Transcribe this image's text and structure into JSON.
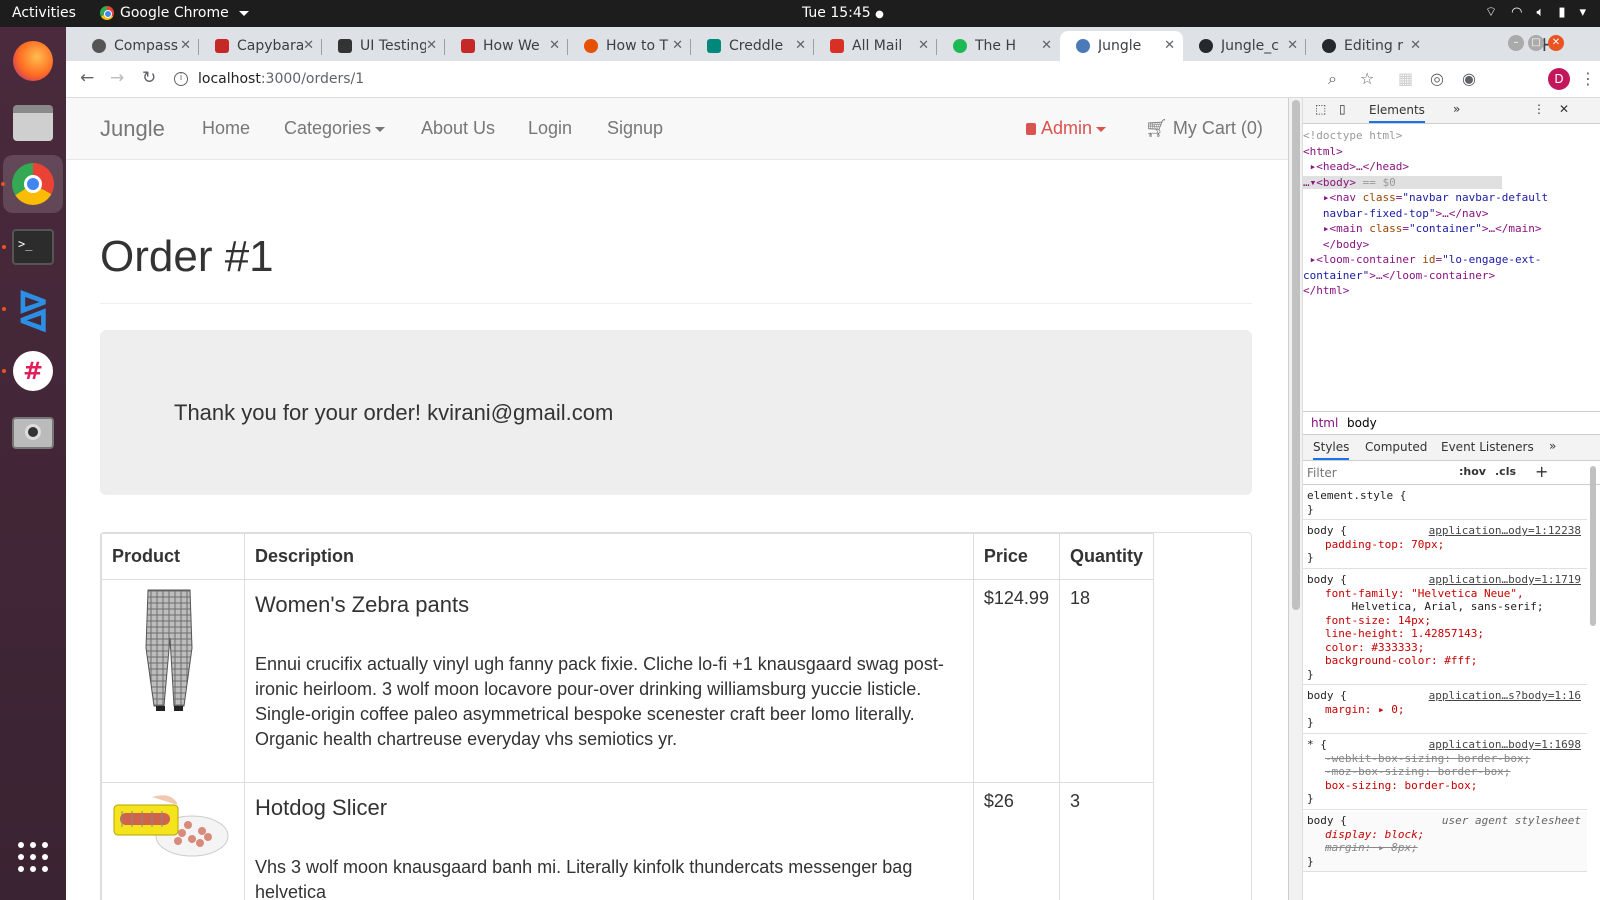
{
  "desktop": {
    "activities": "Activities",
    "app_name": "Google Chrome",
    "clock": "Tue 15:45"
  },
  "tabs": [
    {
      "title": "Compass",
      "color": "#555555"
    },
    {
      "title": "Capybara",
      "color": "#c62828"
    },
    {
      "title": "UI Testing",
      "color": "#333333"
    },
    {
      "title": "How We",
      "color": "#c62828"
    },
    {
      "title": "How to T",
      "color": "#e65100"
    },
    {
      "title": "Creddle",
      "color": "#00897b"
    },
    {
      "title": "All Mail",
      "color": "#d93025"
    },
    {
      "title": "The H",
      "color": "#1db954"
    },
    {
      "title": "Jungle",
      "color": "#4a7ab8"
    },
    {
      "title": "Jungle_c",
      "color": "#24292e"
    },
    {
      "title": "Editing r",
      "color": "#24292e"
    }
  ],
  "address": {
    "host": "localhost",
    "path": ":3000/orders/1"
  },
  "avatar_letter": "D",
  "navbar": {
    "brand": "Jungle",
    "home": "Home",
    "categories": "Categories",
    "about": "About Us",
    "login": "Login",
    "signup": "Signup",
    "admin": "Admin",
    "cart": "My Cart (0)"
  },
  "order": {
    "title": "Order #1",
    "thanks": "Thank you for your order! kvirani@gmail.com"
  },
  "table": {
    "headers": [
      "Product",
      "Description",
      "Price",
      "Quantity"
    ],
    "rows": [
      {
        "name": "Women's Zebra pants",
        "description": "Ennui crucifix actually vinyl ugh fanny pack fixie. Cliche lo-fi +1 knausgaard swag post-ironic heirloom. 3 wolf moon locavore pour-over drinking williamsburg yuccie listicle. Single-origin coffee paleo asymmetrical bespoke scenester craft beer lomo literally. Organic health chartreuse everyday vhs semiotics yr.",
        "price": "$124.99",
        "quantity": "18"
      },
      {
        "name": "Hotdog Slicer",
        "description": "Vhs 3 wolf moon knausgaard banh mi. Literally kinfolk thundercats messenger bag helvetica",
        "price": "$26",
        "quantity": "3"
      }
    ]
  },
  "devtools": {
    "tab_elements": "Elements",
    "breadcrumb": [
      "html",
      "body"
    ],
    "style_tabs": [
      "Styles",
      "Computed",
      "Event Listeners"
    ],
    "filter_placeholder": "Filter",
    "hov": ":hov",
    "cls": ".cls",
    "element_style": "element.style {",
    "rules": [
      {
        "selector": "body {",
        "source": "application…ody=1:12238",
        "lines": [
          "padding-top: 70px;"
        ]
      },
      {
        "selector": "body {",
        "source": "application…body=1:1719",
        "lines": [
          "font-family: \"Helvetica Neue\",",
          "    Helvetica, Arial, sans-serif;",
          "font-size: 14px;",
          "line-height: 1.42857143;",
          "color: #333333;",
          "background-color: #fff;"
        ]
      },
      {
        "selector": "body {",
        "source": "application…s?body=1:16",
        "lines": [
          "margin: ▸ 0;"
        ]
      },
      {
        "selector": "* {",
        "source": "application…body=1:1698",
        "lines": [
          "-webkit-box-sizing: border-box;",
          "-moz-box-sizing: border-box;",
          "box-sizing: border-box;"
        ]
      },
      {
        "selector": "body {",
        "source": "user agent stylesheet",
        "lines": [
          "display: block;",
          "margin: ▸ 8px;"
        ]
      }
    ]
  }
}
